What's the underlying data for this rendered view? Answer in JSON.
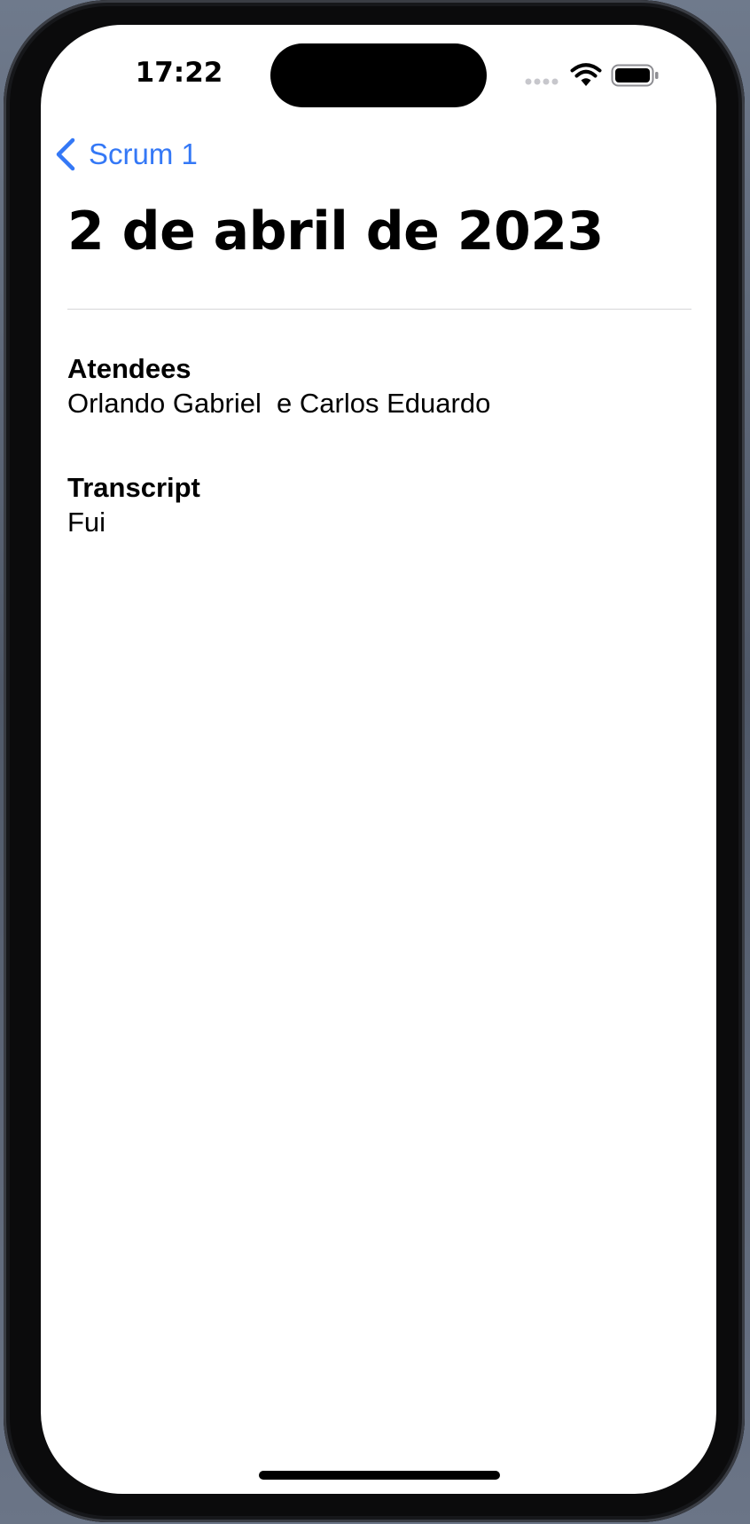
{
  "status_bar": {
    "time": "17:22",
    "icons": [
      "signal-dots-icon",
      "wifi-icon",
      "battery-icon"
    ]
  },
  "nav": {
    "back_label": "Scrum 1",
    "back_icon": "chevron-left-icon",
    "accent_color": "#3478f6"
  },
  "page": {
    "title": "2 de abril de 2023"
  },
  "attendees": {
    "label": "Atendees",
    "value": "Orlando Gabriel  e Carlos Eduardo"
  },
  "transcript": {
    "label": "Transcript",
    "value": "Fui"
  }
}
